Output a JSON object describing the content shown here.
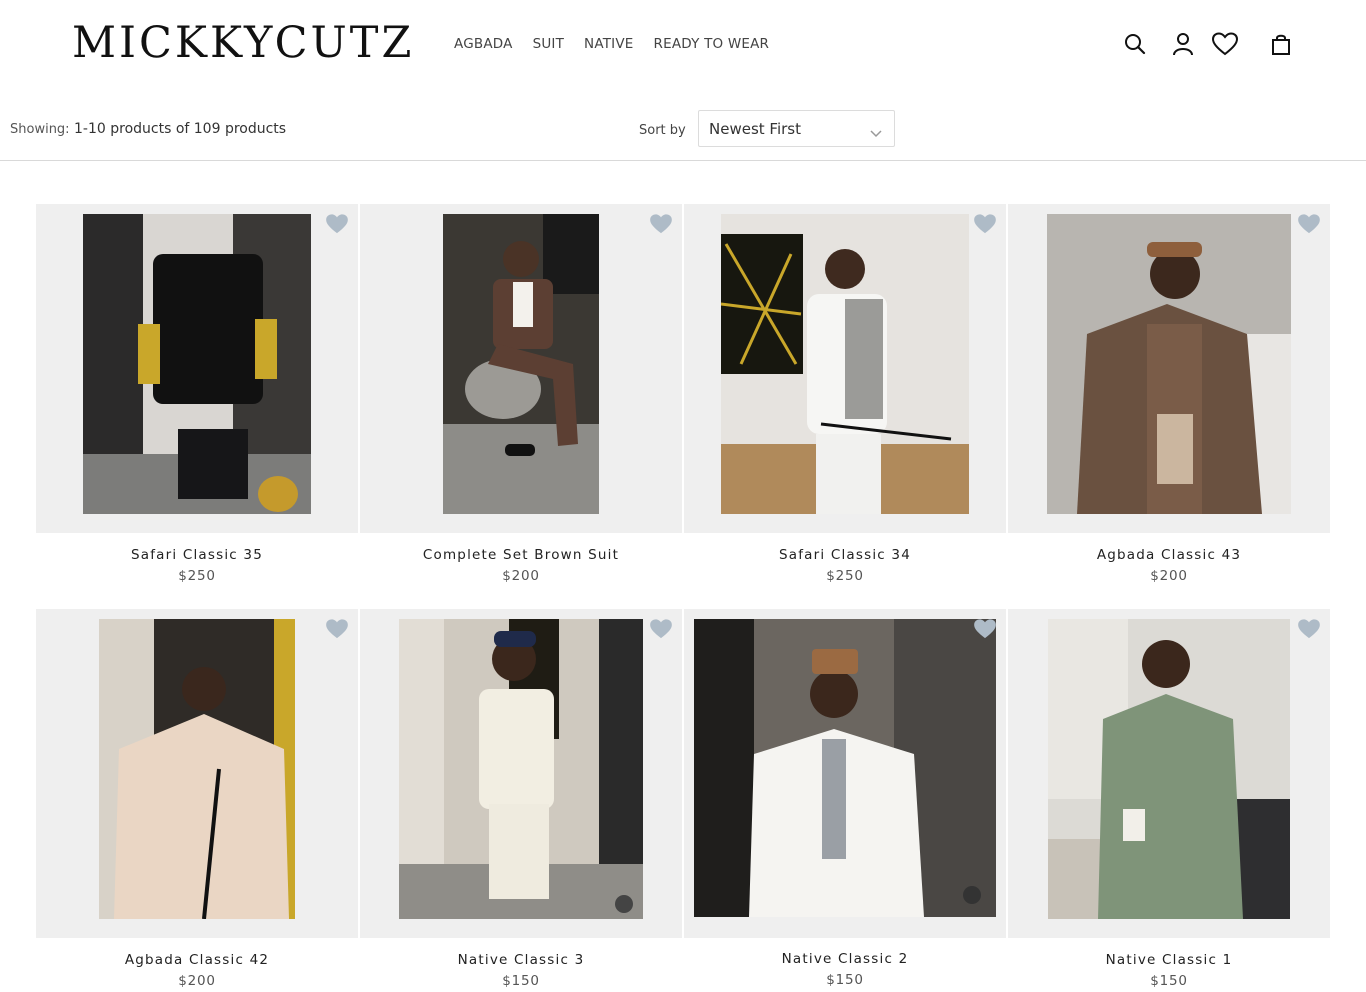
{
  "brand": {
    "logo": "MICKKYCUTZ"
  },
  "nav": [
    {
      "label": "AGBADA"
    },
    {
      "label": "SUIT"
    },
    {
      "label": "NATIVE"
    },
    {
      "label": "READY TO WEAR"
    }
  ],
  "header_icons": [
    "search-icon",
    "account-icon",
    "wishlist-heart-icon",
    "shopping-bag-icon"
  ],
  "toolbar": {
    "showing_label": "Showing:",
    "showing_value": "1-10 products of 109 products",
    "sort_label": "Sort by",
    "sort_value": "Newest First"
  },
  "colors": {
    "card_bg": "#efefef",
    "heart": "#aebbc7",
    "divider": "#d9d9d9"
  },
  "products": [
    {
      "name": "Safari Classic 35",
      "price": "$250",
      "photo": "black safari suit on mannequin"
    },
    {
      "name": "Complete Set Brown Suit",
      "price": "$200",
      "photo": "man seated in brown tuxedo suit"
    },
    {
      "name": "Safari Classic 34",
      "price": "$250",
      "photo": "man in white patterned safari outfit with cane"
    },
    {
      "name": "Agbada Classic 43",
      "price": "$200",
      "photo": "man in brown embroidered agbada"
    },
    {
      "name": "Agbada Classic 42",
      "price": "$200",
      "photo": "man seated in cream agbada with cane"
    },
    {
      "name": "Native Classic 3",
      "price": "$150",
      "photo": "man in cream native outfit"
    },
    {
      "name": "Native Classic 2",
      "price": "$150",
      "photo": "man in white native with grey embroidery"
    },
    {
      "name": "Native Classic 1",
      "price": "$150",
      "photo": "man in sage green native holding cup"
    }
  ]
}
